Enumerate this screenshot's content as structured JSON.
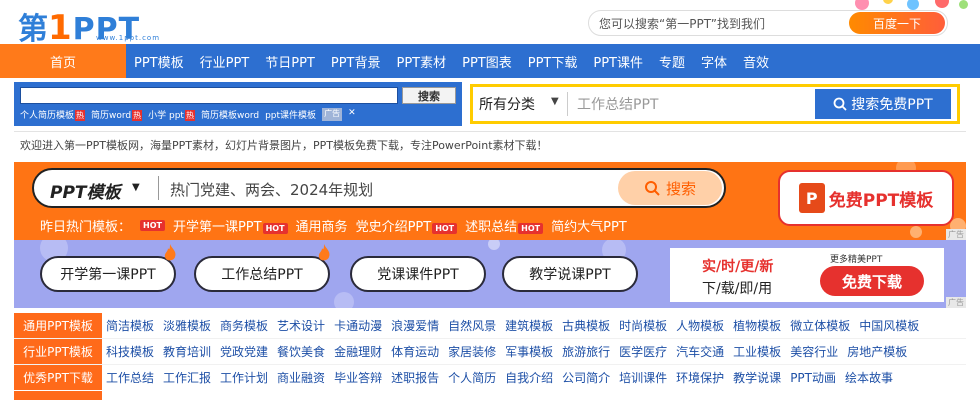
{
  "header": {
    "logo_cn": "第",
    "logo_num": "1",
    "logo_ppt": "PPT",
    "logo_sub": "www.1ppt.com",
    "search_placeholder": "您可以搜索“第一PPT”找到我们",
    "search_button": "百度一下"
  },
  "nav": {
    "home": "首页",
    "items": [
      "PPT模板",
      "行业PPT",
      "节日PPT",
      "PPT背景",
      "PPT素材",
      "PPT图表",
      "PPT下载",
      "PPT课件",
      "专题",
      "字体",
      "音效"
    ]
  },
  "left_search": {
    "button": "搜索",
    "links": [
      {
        "label": "个人简历模板",
        "hot": "热"
      },
      {
        "label": "简历word",
        "hot": "热"
      },
      {
        "label": "小学 ppt",
        "hot": "热"
      },
      {
        "label": "简历模板word",
        "hot": ""
      },
      {
        "label": "ppt课件模板",
        "hot": ""
      }
    ],
    "ad": "广告",
    "close": "✕"
  },
  "right_search": {
    "category": "所有分类",
    "placeholder": "工作总结PPT",
    "button": "搜索免费PPT"
  },
  "welcome": "欢迎进入第一PPT模板网，海量PPT素材，幻灯片背景图片，PPT模板免费下载，专注PowerPoint素材下载！",
  "orange_banner": {
    "category": "PPT模板",
    "placeholder": "热门党建、两会、2024年规划",
    "button": "搜索",
    "hot_label": "昨日热门模板：",
    "hot_badge": "HOT",
    "hot_items": [
      {
        "label": "开学第一课PPT",
        "hot": true
      },
      {
        "label": "通用商务",
        "hot": false
      },
      {
        "label": "党史介绍PPT",
        "hot": true
      },
      {
        "label": "述职总结",
        "hot": true
      },
      {
        "label": "简约大气PPT",
        "hot": false
      }
    ],
    "free_icon": "P",
    "free_text": "免费PPT模板",
    "ad": "广告"
  },
  "purple_banner": {
    "pills": [
      "开学第一课PPT",
      "工作总结PPT",
      "党课课件PPT",
      "教学说课PPT"
    ],
    "slogan1": "实/时/更/新",
    "slogan2": "下/载/即/用",
    "more": "更多精美PPT",
    "button": "免费下载",
    "ad": "广告"
  },
  "categories": [
    {
      "label": "通用PPT模板",
      "links": [
        "简洁模板",
        "淡雅模板",
        "商务模板",
        "艺术设计",
        "卡通动漫",
        "浪漫爱情",
        "自然风景",
        "建筑模板",
        "古典模板",
        "时尚模板",
        "人物模板",
        "植物模板",
        "微立体模板",
        "中国风模板"
      ]
    },
    {
      "label": "行业PPT模板",
      "links": [
        "科技模板",
        "教育培训",
        "党政党建",
        "餐饮美食",
        "金融理财",
        "体育运动",
        "家居装修",
        "军事模板",
        "旅游旅行",
        "医学医疗",
        "汽车交通",
        "工业模板",
        "美容行业",
        "房地产模板"
      ]
    },
    {
      "label": "优秀PPT下载",
      "links": [
        "工作总结",
        "工作汇报",
        "工作计划",
        "商业融资",
        "毕业答辩",
        "述职报告",
        "个人简历",
        "自我介绍",
        "公司简介",
        "培训课件",
        "环境保护",
        "教学说课",
        "PPT动画",
        "绘本故事"
      ]
    }
  ],
  "colors": {
    "brand_blue": "#2d6fd0",
    "accent_orange": "#ff7414",
    "banner_purple": "#9fa6ef",
    "hot_red": "#e6312e"
  }
}
